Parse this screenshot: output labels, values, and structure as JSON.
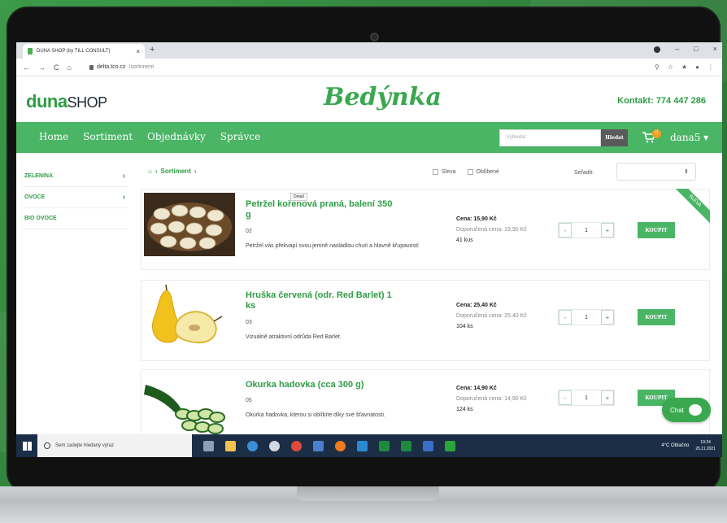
{
  "browser": {
    "tab_title": "DUNA SHOP (by TILL CONSULT)",
    "tab_close": "×",
    "new_tab": "+",
    "url_host": "delta.tco.cz",
    "url_path": "/sortiment",
    "win_min": "–",
    "win_max": "□",
    "win_close": "×",
    "nav_back": "←",
    "nav_forward": "→",
    "nav_reload": "C",
    "nav_home": "⌂",
    "icons": [
      "⚲",
      "☆",
      "★",
      "●",
      "⋮"
    ]
  },
  "header": {
    "logo_a": "duna",
    "logo_b": "SHOP",
    "brand": "Bedýnka",
    "contact": "Kontakt: 774 447 286"
  },
  "nav": {
    "items": [
      "Home",
      "Sortiment",
      "Objednávky",
      "Správce"
    ],
    "search_placeholder": "Vyhledat",
    "search_button": "Hledat",
    "cart_count": "0",
    "user": "dana5 ▾"
  },
  "sidebar": {
    "items": [
      {
        "label": "ZELENINA",
        "chevron": "›"
      },
      {
        "label": "OVOCE",
        "chevron": "›"
      },
      {
        "label": "BIO OVOCE",
        "chevron": ""
      }
    ]
  },
  "toolbar": {
    "breadcrumb_home": "⌂",
    "breadcrumb": "Sortiment",
    "sep": "›",
    "filter_sale": "Sleva",
    "filter_fav": "Oblíbené",
    "sort_label": "Seřadit:",
    "sort_arrow": "⇕"
  },
  "products": [
    {
      "title": "Petržel kořenová praná, balení 350 g",
      "code": "02",
      "desc": "Petržel vás překvapí svou jemně nasládlou chutí a hlavně křupavostí",
      "price": "Cena: 15,90 Kč",
      "recommended": "Doporučená cena: 19,90 Kč",
      "stock": "41 kus",
      "qty": "1",
      "buy": "KOUPIT",
      "ribbon": "SLEVA",
      "tooltip": "Detail"
    },
    {
      "title": "Hruška červená (odr. Red Barlet) 1 ks",
      "code": "03",
      "desc": "Vizuálně atraktivní odrůda Red Barlet.",
      "price": "Cena: 25,40 Kč",
      "recommended": "Doporučená cena: 25,40 Kč",
      "stock": "104 ks",
      "qty": "1",
      "buy": "KOUPIT"
    },
    {
      "title": "Okurka hadovka (cca 300 g)",
      "code": "05",
      "desc": "Okurka hadovka, kterou si oblíbíte díky své šťavnatosti.",
      "price": "Cena: 14,90 Kč",
      "recommended": "Doporučená cena: 14,90 Kč",
      "stock": "124 ks",
      "qty": "1",
      "buy": "KOUPIT"
    }
  ],
  "qty_minus": "-",
  "qty_plus": "+",
  "chat": "Chat",
  "taskbar": {
    "search": "Sem zadejte hledaný výraz",
    "weather": "4°C Oblačno",
    "time": "19:24",
    "date": "25.11.2021"
  },
  "colors": {
    "green": "#4ab565",
    "dark_green": "#2e9d44",
    "taskbar": "#1b2e46"
  }
}
